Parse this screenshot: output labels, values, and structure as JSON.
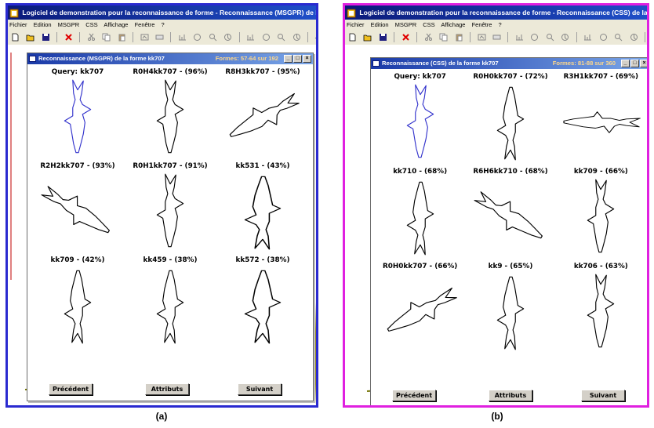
{
  "colors": {
    "frame_a": "#2a2ad0",
    "frame_b": "#e020e0",
    "title_bar": "#0a1a7a",
    "query_outline": "#3333cc",
    "match_outline": "#000000",
    "button_face": "#d4d0c8"
  },
  "icons": [
    "app-icon",
    "new-file-icon",
    "open-folder-icon",
    "save-icon",
    "delete-icon",
    "cut-icon",
    "copy-icon",
    "paste-icon",
    "zoom-icon",
    "help-icon",
    "minimize-icon",
    "maximize-icon",
    "close-icon"
  ],
  "menu": [
    "Fichier",
    "Edition",
    "MSGPR",
    "CSS",
    "Affichage",
    "Fenêtre",
    "?"
  ],
  "panel_a": {
    "caption": "(a)",
    "app_title": "Logiciel de demonstration pour la reconnaissance de forme - Reconnaissance (MSGPR) de la",
    "window_title": "Reconnaissance (MSGPR) de la forme kk707",
    "count": "Formes: 57-64 sur 192",
    "results": [
      {
        "label": "Query: kk707",
        "query": true
      },
      {
        "label": "R0H4kk707 - (96%)"
      },
      {
        "label": "R8H3kk707 - (95%)"
      },
      {
        "label": "R2H2kk707 - (93%)"
      },
      {
        "label": "R0H1kk707 - (91%)"
      },
      {
        "label": "kk531 - (43%)"
      },
      {
        "label": "kk709 - (42%)"
      },
      {
        "label": "kk459 - (38%)"
      },
      {
        "label": "kk572 - (38%)"
      }
    ],
    "buttons": {
      "prev": "Précédent",
      "attr": "Attributs",
      "next": "Suivant"
    }
  },
  "panel_b": {
    "caption": "(b)",
    "app_title": "Logiciel de demonstration pour la reconnaissance de forme - Reconnaissance (CSS) de la f",
    "window_title": "Reconnaissance (CSS) de la forme kk707",
    "count": "Formes: 81-88 sur 360",
    "results": [
      {
        "label": "Query: kk707",
        "query": true
      },
      {
        "label": "R0H0kk707 - (72%)"
      },
      {
        "label": "R3H1kk707 - (69%)"
      },
      {
        "label": "kk710 - (68%)"
      },
      {
        "label": "R6H6kk710 - (68%)"
      },
      {
        "label": "kk709 - (66%)"
      },
      {
        "label": "R0H0kk707 - (66%)"
      },
      {
        "label": "kk9 - (65%)"
      },
      {
        "label": "kk706 - (63%)"
      }
    ],
    "buttons": {
      "prev": "Précédent",
      "attr": "Attributs",
      "next": "Suivant"
    }
  }
}
